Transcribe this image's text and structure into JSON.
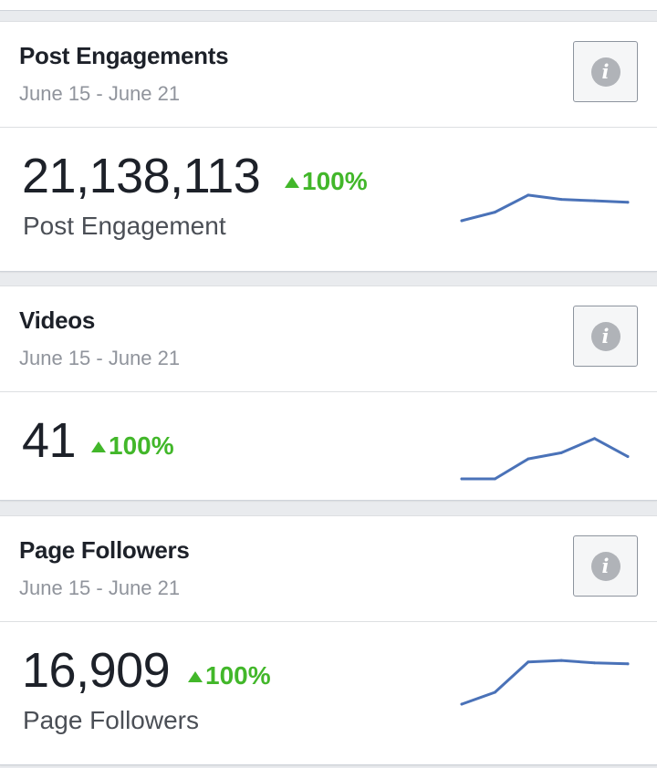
{
  "colors": {
    "accent_line": "#4a72b8",
    "positive": "#42b72a",
    "background": "#e9ebee"
  },
  "cards": [
    {
      "title": "Post Engagements",
      "date_range": "June 15 - June 21",
      "info_icon": "info-icon",
      "value": "21,138,113",
      "change": "100%",
      "change_icon": "up-arrow-icon",
      "label": "Post Engagement",
      "trend": [
        0,
        0.18,
        0.54,
        0.45,
        0.42,
        0.39
      ]
    },
    {
      "title": "Videos",
      "date_range": "June 15 - June 21",
      "info_icon": "info-icon",
      "value": "41",
      "change": "100%",
      "change_icon": "up-arrow-icon",
      "label": "",
      "trend": [
        0,
        0,
        0.42,
        0.55,
        0.85,
        0.47
      ]
    },
    {
      "title": "Page Followers",
      "date_range": "June 15 - June 21",
      "info_icon": "info-icon",
      "value": "16,909",
      "change": "100%",
      "change_icon": "up-arrow-icon",
      "label": "Page Followers",
      "trend": [
        0,
        0.25,
        0.89,
        0.92,
        0.87,
        0.85
      ]
    }
  ]
}
